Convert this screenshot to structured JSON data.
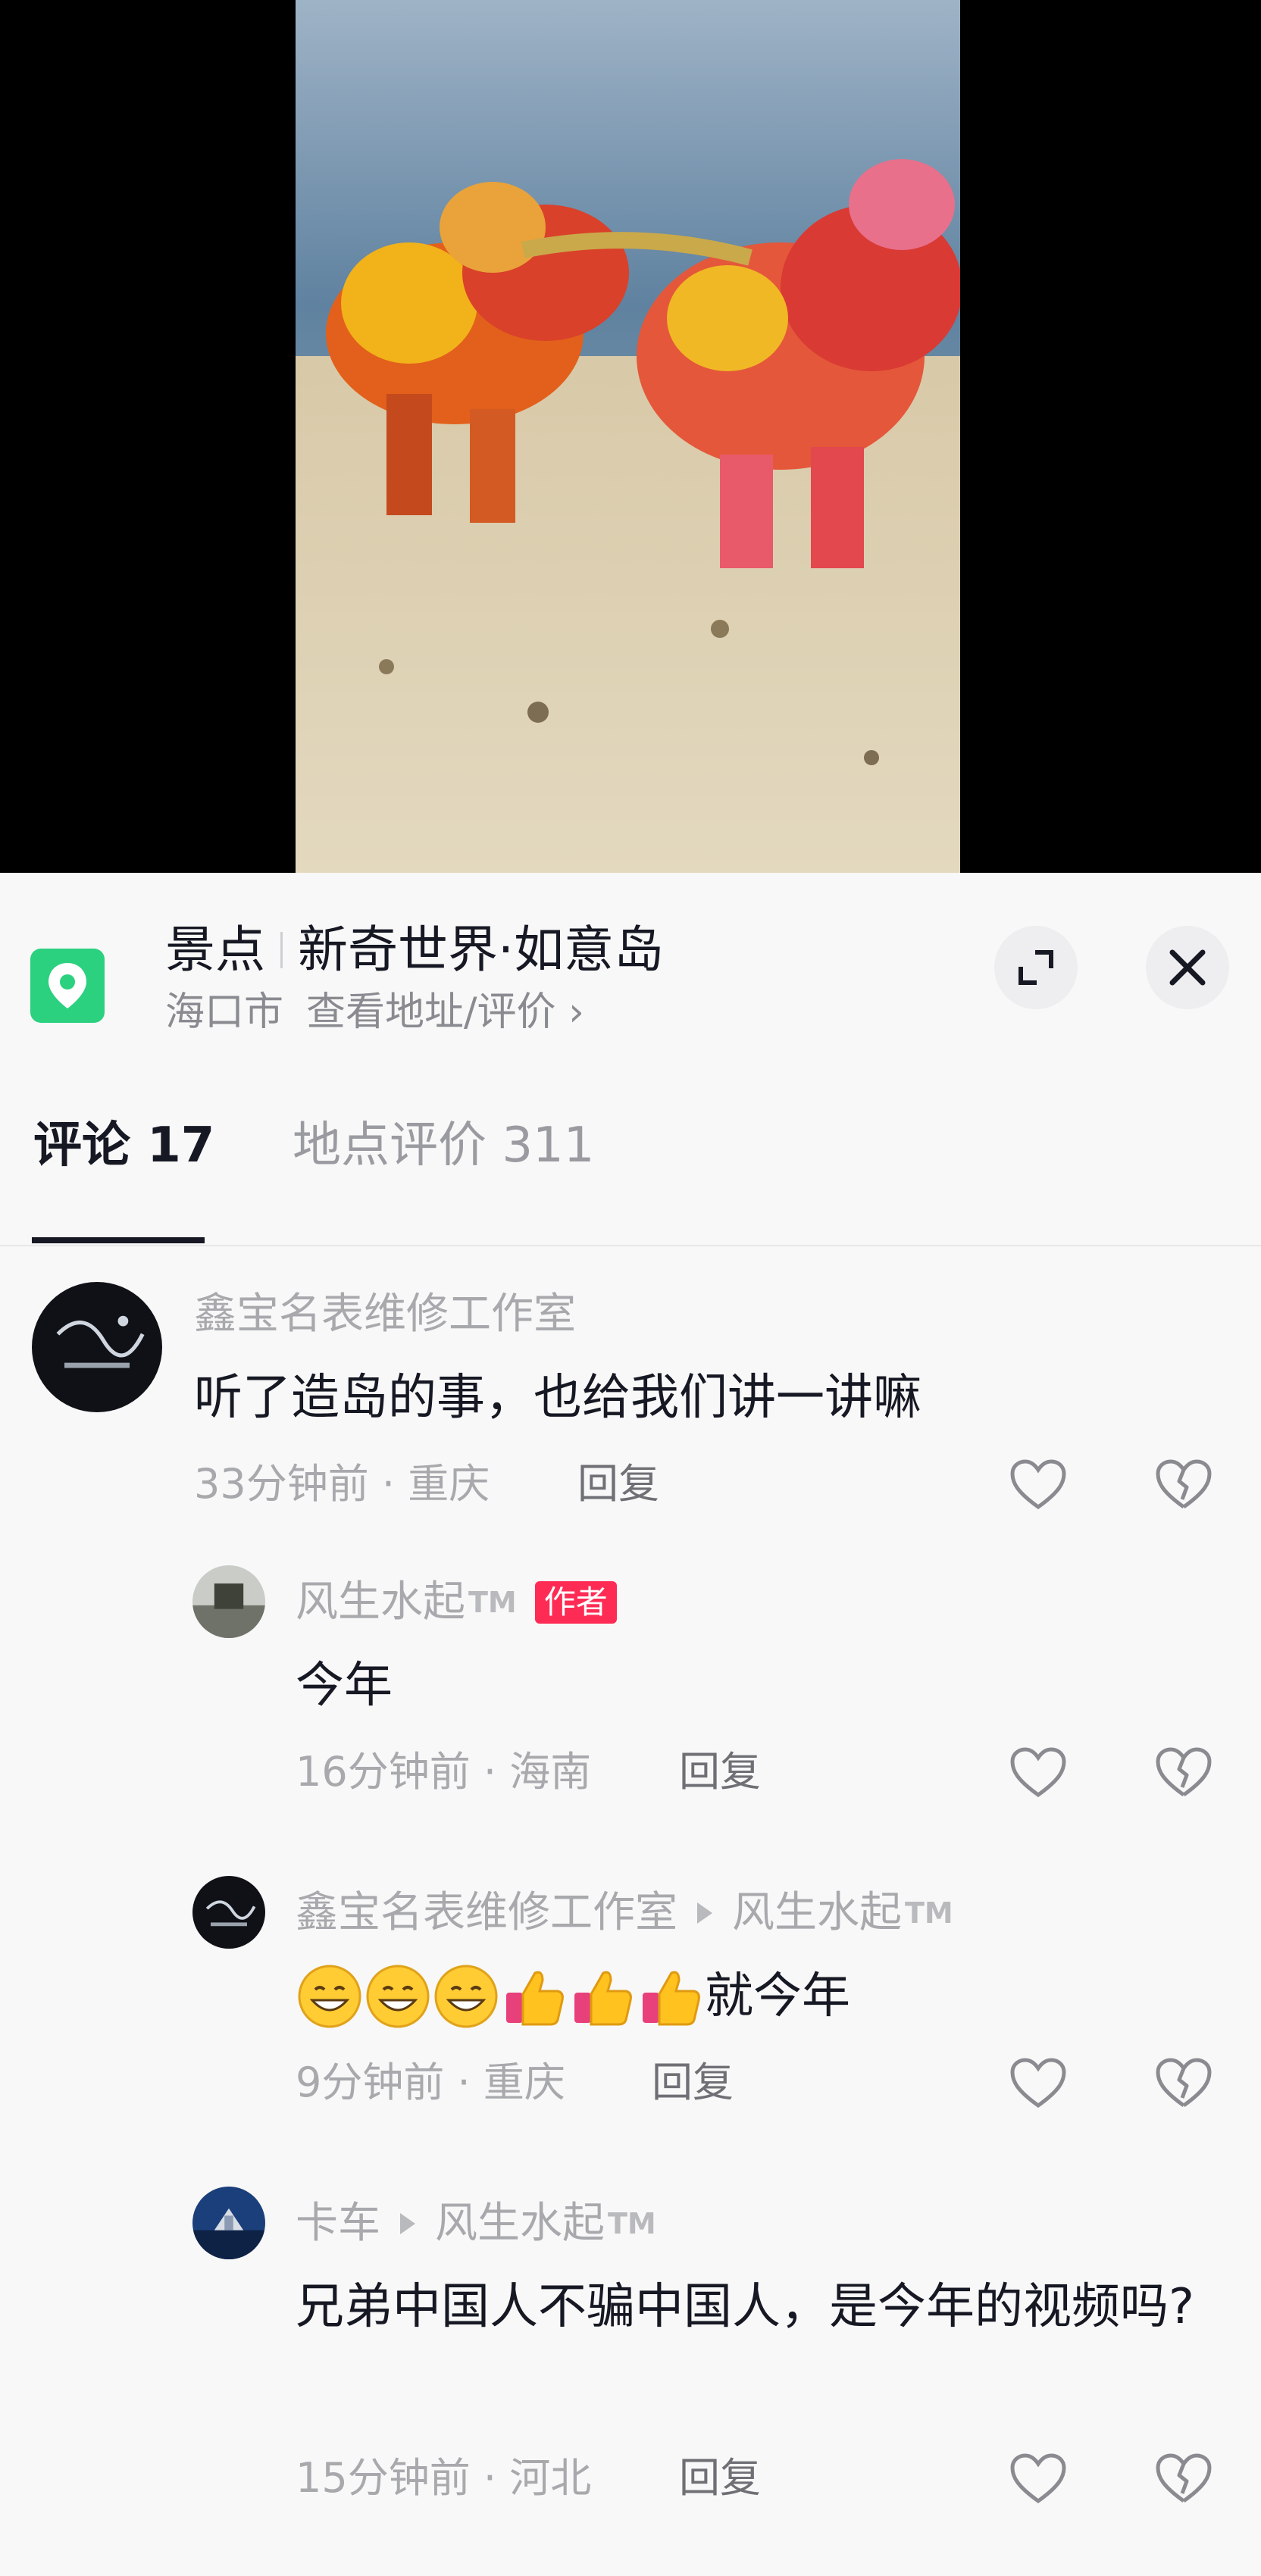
{
  "location": {
    "category": "景点",
    "name": "新奇世界·如意岛",
    "city": "海口市",
    "link_label": "查看地址/评价",
    "link_chevron": "›"
  },
  "tabs": {
    "comments_label": "评论 17",
    "reviews_label": "地点评价 311"
  },
  "comments": [
    {
      "user": "鑫宝名表维修工作室",
      "text": "听了造岛的事，也给我们讲一讲嘛",
      "time_location": "33分钟前 · 重庆",
      "reply_label": "回复"
    },
    {
      "user": "风生水起",
      "user_suffix": "TM",
      "badge": "作者",
      "text": "今年",
      "time_location": "16分钟前 · 海南",
      "reply_label": "回复"
    },
    {
      "user": "鑫宝名表维修工作室",
      "reply_to": "风生水起",
      "reply_to_suffix": "TM",
      "text": "就今年",
      "time_location": "9分钟前 · 重庆",
      "reply_label": "回复"
    },
    {
      "user": "卡车",
      "reply_to": "风生水起",
      "reply_to_suffix": "TM",
      "text": "兄弟中国人不骗中国人，是今年的视频吗?",
      "time_location": "15分钟前 · 河北",
      "reply_label": "回复"
    }
  ],
  "icons": {
    "location": "map-pin-icon",
    "expand": "expand-icon",
    "close": "close-icon",
    "like": "heart-icon",
    "dislike": "broken-heart-icon",
    "grin": "grinning-face-emoji",
    "thumbs_up": "thumbs-up-emoji"
  },
  "colors": {
    "location_green": "#2bd17e",
    "author_badge": "#fe2c55",
    "text_primary": "#161823",
    "text_secondary": "#a8a9ad"
  }
}
